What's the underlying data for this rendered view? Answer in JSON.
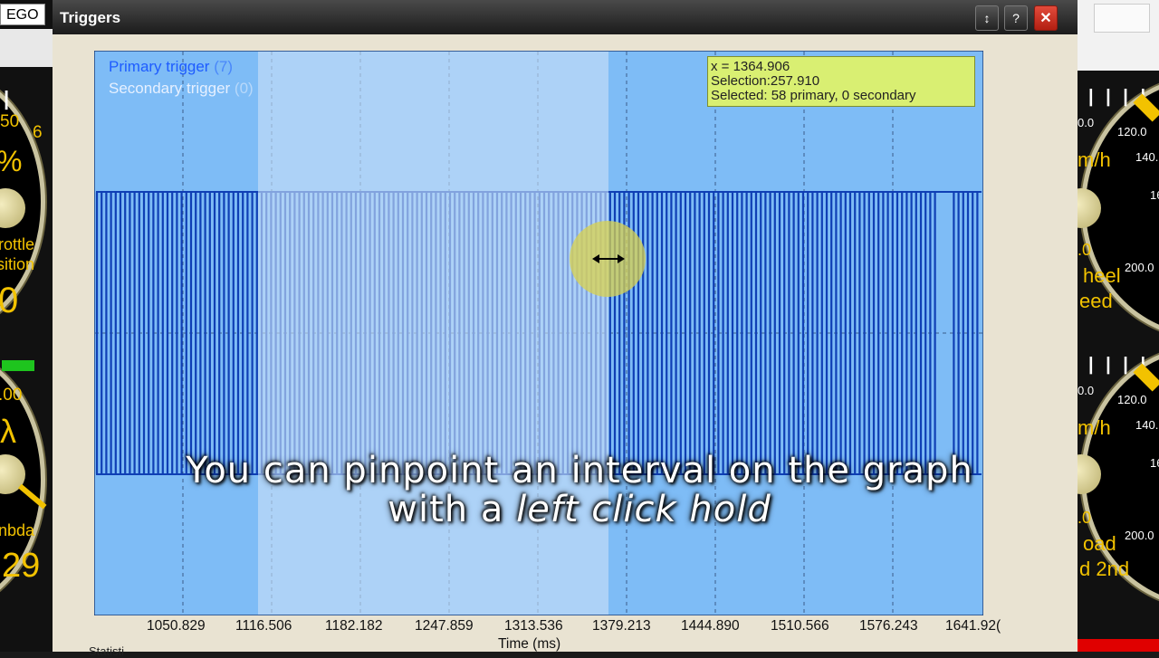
{
  "background": {
    "ego_tab": "EGO",
    "left_gauges": [
      {
        "lines": [
          "50",
          "6",
          "%"
        ],
        "label": [
          "rottle",
          "sition"
        ],
        "value": "0"
      },
      {
        "lines": [
          ".00",
          "λ"
        ],
        "label": [
          "nbda"
        ],
        "value": "29"
      }
    ],
    "right_gauges": [
      {
        "ticks": [
          "0.0",
          "120.0",
          "140.",
          "16",
          ".0",
          "200.0"
        ],
        "unit": "m/h",
        "label": [
          "heel",
          "eed"
        ]
      },
      {
        "ticks": [
          "0.0",
          "120.0",
          "140.",
          "16",
          ".0",
          "200.0"
        ],
        "unit": "m/h",
        "label": [
          "oad",
          "d 2nd"
        ]
      }
    ]
  },
  "window": {
    "title": "Triggers",
    "buttons": {
      "resize": "↕",
      "help": "?",
      "close": "✕"
    }
  },
  "graph": {
    "legend_primary": "Primary trigger",
    "legend_primary_count": "(7)",
    "legend_secondary": "Secondary trigger",
    "legend_secondary_count": "(0)",
    "info": {
      "x": "x = 1364.906",
      "selection": "Selection:257.910",
      "selected": "Selected: 58 primary, 0 secondary"
    },
    "x_ticks": [
      "1050.829",
      "1116.506",
      "1182.182",
      "1247.859",
      "1313.536",
      "1379.213",
      "1444.890",
      "1510.566",
      "1576.243",
      "1641.92("
    ],
    "x_label": "Time (ms)",
    "below_label": "Statisti",
    "colors": {
      "background": "#7ebcf6",
      "pulses": "#0f3fb5",
      "selection": "#c9e1f7",
      "cursor_halo": "#d9d24e"
    }
  },
  "subtitle": {
    "line1": "You can pinpoint an interval on the graph",
    "line2_prefix": "with a ",
    "line2_emph": "left click hold"
  }
}
